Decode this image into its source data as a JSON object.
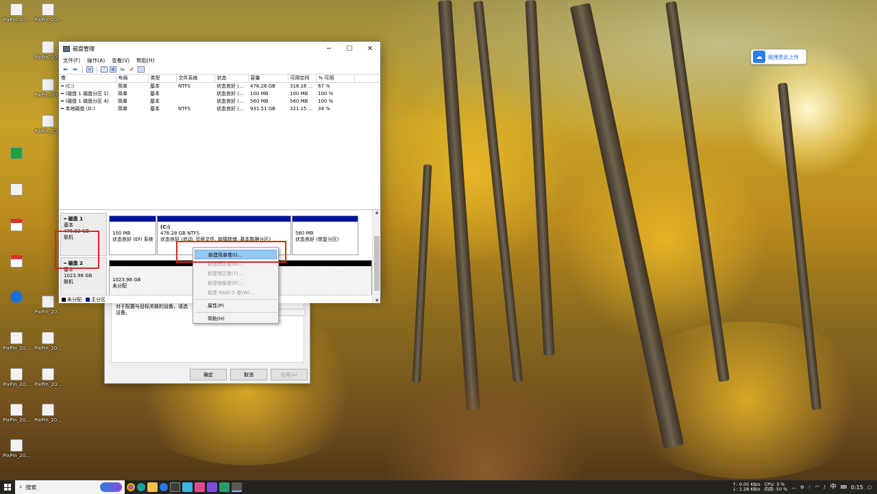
{
  "window": {
    "title": "磁盘管理",
    "controls": {
      "minimize": "─",
      "maximize": "☐",
      "close": "✕"
    }
  },
  "menu": [
    "文件(F)",
    "操作(A)",
    "查看(V)",
    "帮助(H)"
  ],
  "toolbar_icons": [
    "back-icon",
    "forward-icon",
    "list-view-icon",
    "help-icon",
    "properties-icon",
    "connect-icon",
    "check-icon",
    "panel-icon"
  ],
  "volume_table": {
    "columns": [
      "卷",
      "布局",
      "类型",
      "文件系统",
      "状态",
      "容量",
      "可用空间",
      "% 可用"
    ],
    "rows": [
      [
        "(C:)",
        "简单",
        "基本",
        "NTFS",
        "状态良好 (...",
        "476.28 GB",
        "318.16 ...",
        "67 %"
      ],
      [
        "(磁盘 1 磁盘分区 1)",
        "简单",
        "基本",
        "",
        "状态良好 (...",
        "100 MB",
        "100 MB",
        "100 %"
      ],
      [
        "(磁盘 1 磁盘分区 4)",
        "简单",
        "基本",
        "",
        "状态良好 (...",
        "560 MB",
        "560 MB",
        "100 %"
      ],
      [
        "本地磁盘 (D:)",
        "简单",
        "基本",
        "NTFS",
        "状态良好 (...",
        "931.51 GB",
        "321.15 ...",
        "34 %"
      ]
    ]
  },
  "disks": [
    {
      "name": "磁盘 1",
      "type": "基本",
      "size": "476.92 GB",
      "status": "联机",
      "partitions": [
        {
          "line1": "100 MB",
          "line2": "状态良好 (EFI 系统"
        },
        {
          "title": "(C:)",
          "line1": "476.28 GB NTFS",
          "line2": "状态良好 (启动, 页面文件, 故障转储, 基本数据分区)"
        },
        {
          "line1": "560 MB",
          "line2": "状态良好 (恢复分区)"
        }
      ]
    },
    {
      "name": "磁盘 2",
      "type": "基本",
      "size": "1023.98 GB",
      "status": "联机",
      "partitions": [
        {
          "line1": "1023.98 GB",
          "line2": "未分配"
        }
      ]
    }
  ],
  "legend": {
    "unallocated": "未分配",
    "primary": "主分区"
  },
  "context_menu": {
    "items": [
      {
        "label": "新建简单卷(I)...",
        "enabled": true
      },
      {
        "label": "新建跨区卷(N)...",
        "enabled": false
      },
      {
        "label": "新建带区卷(T)...",
        "enabled": false
      },
      {
        "label": "新建镜像卷(R)...",
        "enabled": false
      },
      {
        "label": "新建 RAID-5 卷(W)...",
        "enabled": false
      }
    ],
    "properties": "属性(P)",
    "help": "帮助(H)"
  },
  "dialog": {
    "text_line1": "对于配置与目标关联的设备，请选",
    "text_line2": "设备。",
    "ok": "确定",
    "cancel": "取消",
    "apply": "应用(A)"
  },
  "upload_widget": {
    "label": "拖拽至此上传"
  },
  "desktop_icons": [
    "PixPin_20...",
    "PixPin_20...",
    "PixPin_20...",
    "PixPin_20...",
    "PixPin_20...",
    "PixPin_20...",
    "PixPin_20...",
    "PixPin_20...",
    "PixPin_20...",
    "PixPin_20...",
    "PixPin_20...",
    "PixPin_20...",
    "PixPin_20..."
  ],
  "taskbar": {
    "search_placeholder": "搜索",
    "net_up": "↑: 0.05 KB/s",
    "net_down": "↓: 1.28 KB/s",
    "cpu": "CPU: 3 %",
    "mem": "内存: 50 %",
    "ime": "中",
    "time": "0:15"
  },
  "colors": {
    "primary_partition": "#00129c",
    "unallocated": "#000000",
    "highlight_box": "#e2241b",
    "menu_highlight": "#91c9f7"
  }
}
